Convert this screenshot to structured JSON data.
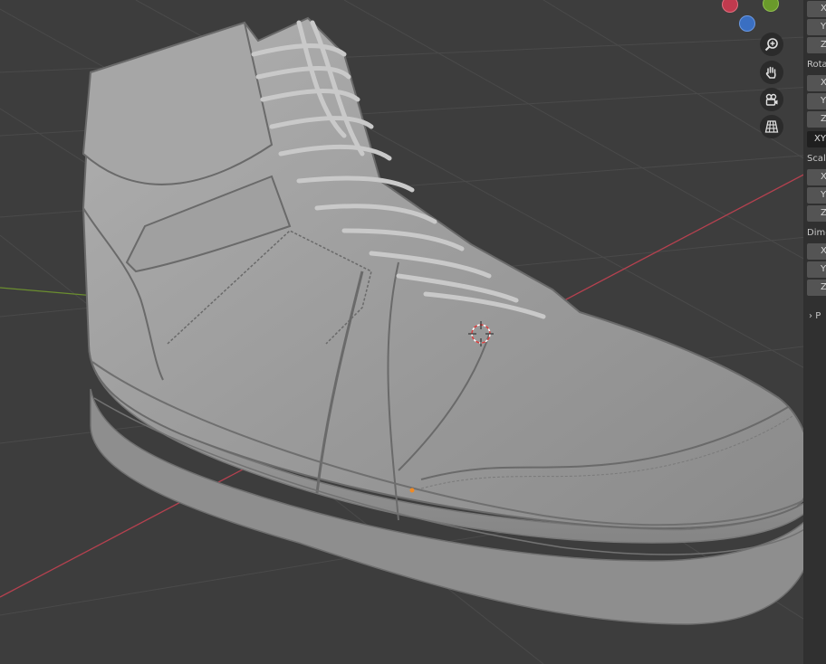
{
  "viewport": {
    "background": "#3d3d3d",
    "grid_color": "#4a4a4a",
    "x_axis_color": "#b5414f",
    "y_axis_color": "#6b8e2f",
    "object_color": "#9a9a9a",
    "cursor_icon": "3d-cursor-icon",
    "origin_icon": "origin-dot-icon"
  },
  "gizmo": {
    "x_color": "#c03a4e",
    "y_color": "#6a9a2b",
    "z_color": "#3a6fc2"
  },
  "nav_buttons": [
    {
      "icon": "zoom-icon"
    },
    {
      "icon": "hand-pan-icon"
    },
    {
      "icon": "camera-icon"
    },
    {
      "icon": "grid-ortho-icon"
    }
  ],
  "sidebar": {
    "location": {
      "x": "X",
      "y": "Y",
      "z": "Z"
    },
    "rotation": {
      "label": "Rota",
      "x": "X",
      "y": "Y",
      "z": "Z",
      "mode": "XY"
    },
    "scale": {
      "label": "Scal",
      "x": "X",
      "y": "Y",
      "z": "Z"
    },
    "dimensions": {
      "label": "Dime",
      "x": "X",
      "y": "Y",
      "z": "Z"
    },
    "properties": {
      "label": "P"
    }
  }
}
